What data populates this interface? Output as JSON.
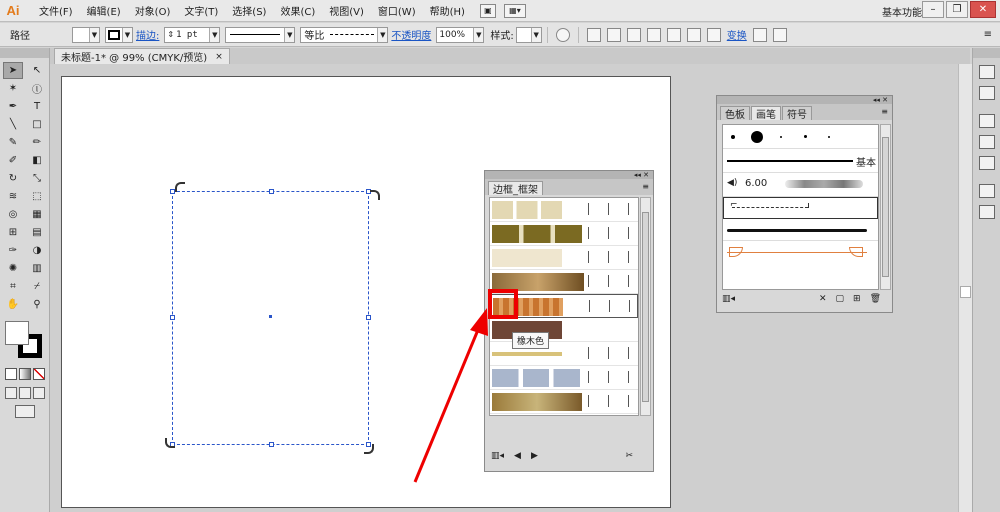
{
  "app": {
    "logo": "Ai",
    "workspace": "基本功能"
  },
  "menu": [
    "文件(F)",
    "编辑(E)",
    "对象(O)",
    "文字(T)",
    "选择(S)",
    "效果(C)",
    "视图(V)",
    "窗口(W)",
    "帮助(H)"
  ],
  "control_bar": {
    "object_label": "路径",
    "stroke_link": "描边:",
    "stroke_weight": "1 pt",
    "stroke_profile": "等比",
    "opacity_link": "不透明度",
    "opacity_value": "100%",
    "style_label": "样式:",
    "transform_link": "变换"
  },
  "document_tab": {
    "title": "未标题-1* @ 99% (CMYK/预览)",
    "close": "×"
  },
  "library_panel": {
    "tab": "边框_框架",
    "tooltip": "橡木色",
    "selected_index": 4
  },
  "brush_panel": {
    "tabs": [
      "色板",
      "画笔",
      "符号"
    ],
    "active_tab": "画笔",
    "basic_label": "基本",
    "size_value": "6.00"
  },
  "colors": {
    "selection": "#2a55c9",
    "highlight": "#e00000",
    "logo": "#e37b1c"
  }
}
